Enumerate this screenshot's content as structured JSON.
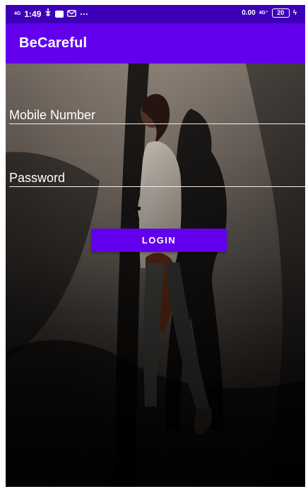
{
  "status_bar": {
    "network_left": "4G",
    "time": "1:49",
    "more": "···",
    "data_speed": "0.00",
    "network_right": "4G⁺",
    "battery": "20"
  },
  "app_bar": {
    "title": "BeCareful"
  },
  "form": {
    "mobile_placeholder": "Mobile Number",
    "mobile_value": "",
    "password_placeholder": "Password",
    "password_value": "",
    "login_label": "LOGIN"
  },
  "icons": [
    "signal-icon",
    "usb-icon",
    "notification-icon",
    "mail-icon",
    "battery-icon"
  ],
  "colors": {
    "status_bar": "#3d00b8",
    "app_bar": "#6200ee",
    "button": "#6200ee",
    "text": "#ffffff",
    "input_line": "#f2efe8"
  }
}
